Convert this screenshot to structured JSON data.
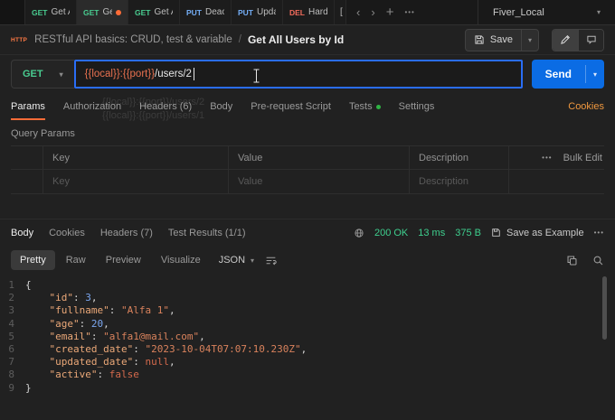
{
  "colors": {
    "accent_orange": "#ff6c37",
    "focus_blue": "#2a6df5",
    "send_blue": "#0b6ce4",
    "status_green": "#3ecf8e",
    "tests_dot_green": "#2fb344",
    "variable_orange": "#e8714f",
    "cookies_link": "#f0983f"
  },
  "tabbar": {
    "method_colors": {
      "GET": "#49cc90",
      "PUT": "#74aef6",
      "DEL": "#f36c5c"
    },
    "tabs": [
      {
        "method": "GET",
        "label": "Get All",
        "dirty": false,
        "active": false
      },
      {
        "method": "GET",
        "label": "Get",
        "dirty": true,
        "active": true
      },
      {
        "method": "GET",
        "label": "Get Ac",
        "dirty": false,
        "active": false
      },
      {
        "method": "PUT",
        "label": "Deactiv",
        "dirty": false,
        "active": false
      },
      {
        "method": "PUT",
        "label": "Update",
        "dirty": false,
        "active": false
      },
      {
        "method": "DEL",
        "label": "Hard D",
        "dirty": false,
        "active": false
      }
    ],
    "partial_tab": "[",
    "scroll_left": "‹",
    "scroll_right": "›",
    "new_tab": "+",
    "more": "•••",
    "environment": "Fiver_Local"
  },
  "breadcrumb": {
    "badge": "HTTP",
    "collection": "RESTful API basics: CRUD, test & variable",
    "separator": "/",
    "request_name": "Get All Users by Id",
    "save_label": "Save"
  },
  "request": {
    "method": "GET",
    "url_segments": [
      {
        "type": "var",
        "text": "{{local}}:{{port}}"
      },
      {
        "type": "plain",
        "text": "/users/2"
      }
    ],
    "send_label": "Send"
  },
  "request_tabs": {
    "items": [
      {
        "label": "Params",
        "active": true
      },
      {
        "label": "Authorization"
      },
      {
        "label": "Headers",
        "count": "(6)"
      },
      {
        "label": "Body"
      },
      {
        "label": "Pre-request Script"
      },
      {
        "label": "Tests",
        "dot": true
      },
      {
        "label": "Settings"
      }
    ],
    "cookies_link": "Cookies"
  },
  "ghost_text": {
    "line1": "{{local}}:{{port}}/users/2",
    "line2": "{{local}}:{{port}}/users/1"
  },
  "query_params": {
    "title": "Query Params",
    "columns": [
      "Key",
      "Value",
      "Description"
    ],
    "more": "•••",
    "bulk_edit": "Bulk Edit",
    "row_placeholders": [
      "Key",
      "Value",
      "Description"
    ]
  },
  "response": {
    "tabs": [
      {
        "label": "Body",
        "active": true
      },
      {
        "label": "Cookies"
      },
      {
        "label": "Headers",
        "count": "(7)"
      },
      {
        "label": "Test Results",
        "count": "(1/1)"
      }
    ],
    "status": "200 OK",
    "time": "13 ms",
    "size": "375 B",
    "save_as_example": "Save as Example",
    "more": "•••",
    "view_tabs": [
      {
        "label": "Pretty",
        "active": true
      },
      {
        "label": "Raw"
      },
      {
        "label": "Preview"
      },
      {
        "label": "Visualize"
      }
    ],
    "language": "JSON"
  },
  "response_body": {
    "syntax_colors": {
      "key": "#eba878",
      "string": "#d9825c",
      "number": "#7ba7f0",
      "literal": "#d3694c"
    },
    "lines": [
      {
        "num": 1,
        "segs": [
          [
            "punct",
            "{"
          ]
        ]
      },
      {
        "num": 2,
        "segs": [
          [
            "punct",
            "    "
          ],
          [
            "key",
            "\"id\""
          ],
          [
            "punct",
            ": "
          ],
          [
            "num",
            "3"
          ],
          [
            "punct",
            ","
          ]
        ]
      },
      {
        "num": 3,
        "segs": [
          [
            "punct",
            "    "
          ],
          [
            "key",
            "\"fullname\""
          ],
          [
            "punct",
            ": "
          ],
          [
            "str",
            "\"Alfa 1\""
          ],
          [
            "punct",
            ","
          ]
        ]
      },
      {
        "num": 4,
        "segs": [
          [
            "punct",
            "    "
          ],
          [
            "key",
            "\"age\""
          ],
          [
            "punct",
            ": "
          ],
          [
            "num",
            "20"
          ],
          [
            "punct",
            ","
          ]
        ]
      },
      {
        "num": 5,
        "segs": [
          [
            "punct",
            "    "
          ],
          [
            "key",
            "\"email\""
          ],
          [
            "punct",
            ": "
          ],
          [
            "str",
            "\"alfa1@mail.com\""
          ],
          [
            "punct",
            ","
          ]
        ]
      },
      {
        "num": 6,
        "segs": [
          [
            "punct",
            "    "
          ],
          [
            "key",
            "\"created_date\""
          ],
          [
            "punct",
            ": "
          ],
          [
            "str",
            "\"2023-10-04T07:07:10.230Z\""
          ],
          [
            "punct",
            ","
          ]
        ]
      },
      {
        "num": 7,
        "segs": [
          [
            "punct",
            "    "
          ],
          [
            "key",
            "\"updated_date\""
          ],
          [
            "punct",
            ": "
          ],
          [
            "lit",
            "null"
          ],
          [
            "punct",
            ","
          ]
        ]
      },
      {
        "num": 8,
        "segs": [
          [
            "punct",
            "    "
          ],
          [
            "key",
            "\"active\""
          ],
          [
            "punct",
            ": "
          ],
          [
            "lit",
            "false"
          ]
        ]
      },
      {
        "num": 9,
        "segs": [
          [
            "punct",
            "}"
          ]
        ]
      }
    ]
  }
}
